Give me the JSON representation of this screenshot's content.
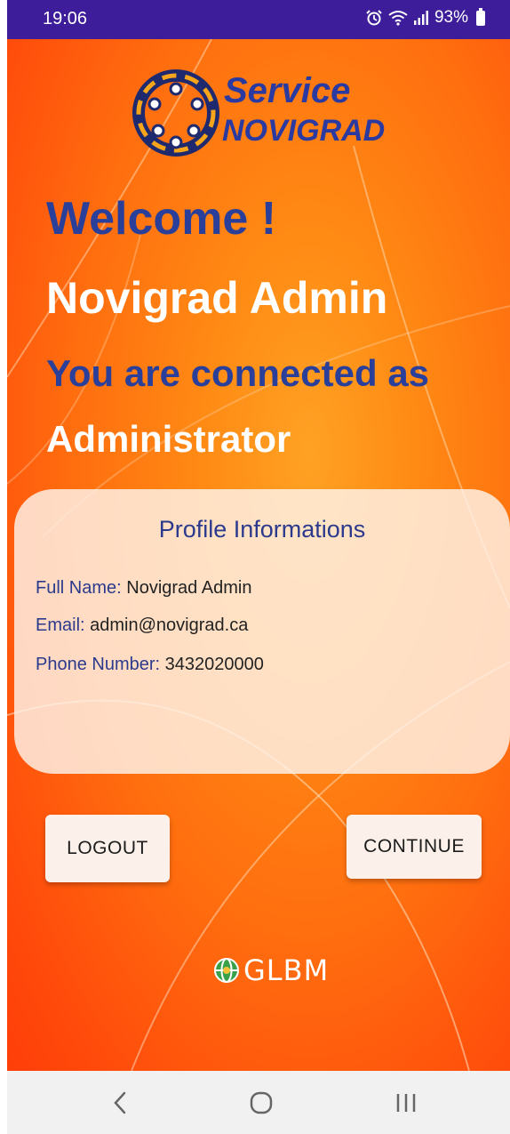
{
  "status_bar": {
    "time": "19:06",
    "battery": "93%",
    "icons": [
      "alarm-icon",
      "wifi-icon",
      "signal-icon",
      "battery-icon"
    ]
  },
  "logo": {
    "line1": "Service",
    "line2": "NOVIGRAD"
  },
  "headline": {
    "welcome": "Welcome !",
    "name": "Novigrad  Admin",
    "connected": "You are connected as",
    "role": "Administrator"
  },
  "profile": {
    "title": "Profile Informations",
    "full_name_label": "Full Name:",
    "full_name_value": "Novigrad  Admin",
    "email_label": "Email:",
    "email_value": "admin@novigrad.ca",
    "phone_label": "Phone Number:",
    "phone_value": "3432020000"
  },
  "buttons": {
    "logout": "LOGOUT",
    "continue": "CONTINUE"
  },
  "footer": {
    "brand": "GLBM"
  },
  "nav": {
    "icons": [
      "back-icon",
      "home-icon",
      "recent-apps-icon"
    ]
  },
  "colors": {
    "status_bar": "#3d1d9a",
    "accent_blue": "#2a3f99",
    "background_orange": "#ff6e0f",
    "card": "#fff4eb"
  }
}
